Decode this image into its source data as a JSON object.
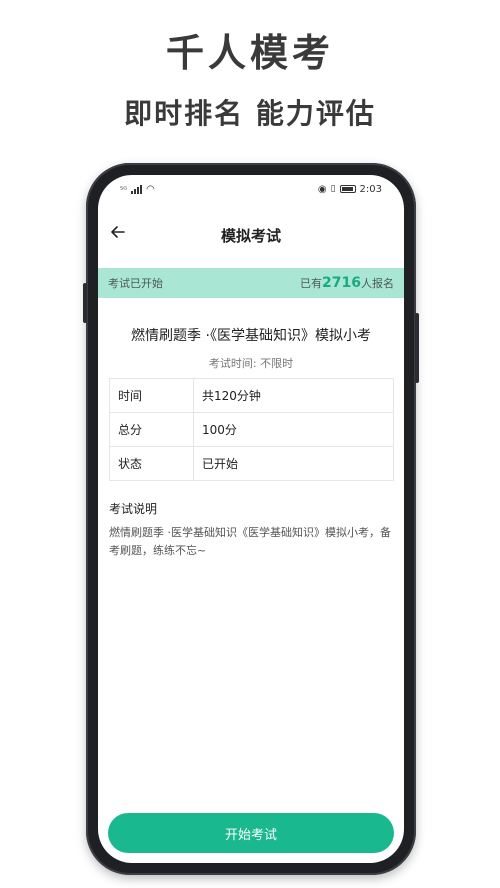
{
  "promo": {
    "title": "千人模考",
    "subtitle": "即时排名  能力评估"
  },
  "status_bar": {
    "network_label": "⁵ᴳ",
    "time": "2:03"
  },
  "nav": {
    "title": "模拟考试"
  },
  "banner": {
    "status": "考试已开始",
    "count_prefix": "已有",
    "count": "2716",
    "count_suffix": "人报名"
  },
  "exam": {
    "title": "燃情刷题季 ·《医学基础知识》模拟小考",
    "time_limit": "考试时间: 不限时"
  },
  "info_rows": [
    {
      "label": "时间",
      "value": "共120分钟"
    },
    {
      "label": "总分",
      "value": "100分"
    },
    {
      "label": "状态",
      "value": "已开始"
    }
  ],
  "description": {
    "heading": "考试说明",
    "text": "燃情刷题季 ·医学基础知识《医学基础知识》模拟小考，备考刷题，练练不忘~"
  },
  "actions": {
    "start_label": "开始考试"
  },
  "colors": {
    "accent": "#19b88f",
    "banner_bg": "#a9e6d3",
    "count_color": "#1aaa80"
  }
}
